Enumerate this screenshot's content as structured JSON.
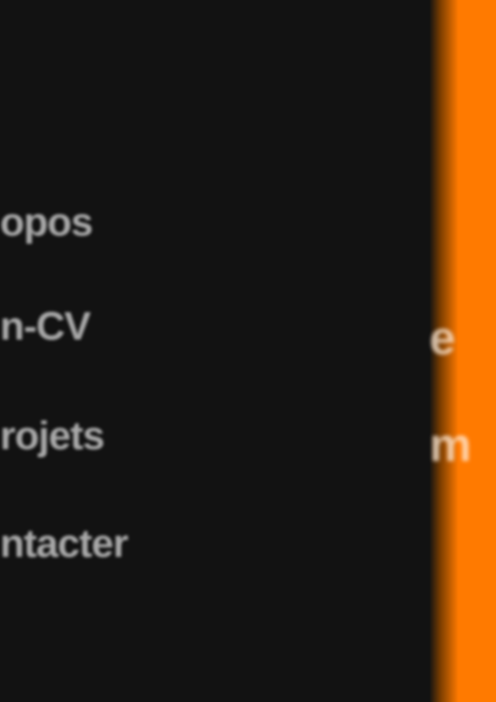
{
  "nav": {
    "items": [
      {
        "label": "opos"
      },
      {
        "label": "n-CV"
      },
      {
        "label": "rojets"
      },
      {
        "label": "ntacter"
      }
    ]
  },
  "side_panel": {
    "accent_color": "#ff7a00",
    "lines": [
      "e",
      "m"
    ]
  }
}
